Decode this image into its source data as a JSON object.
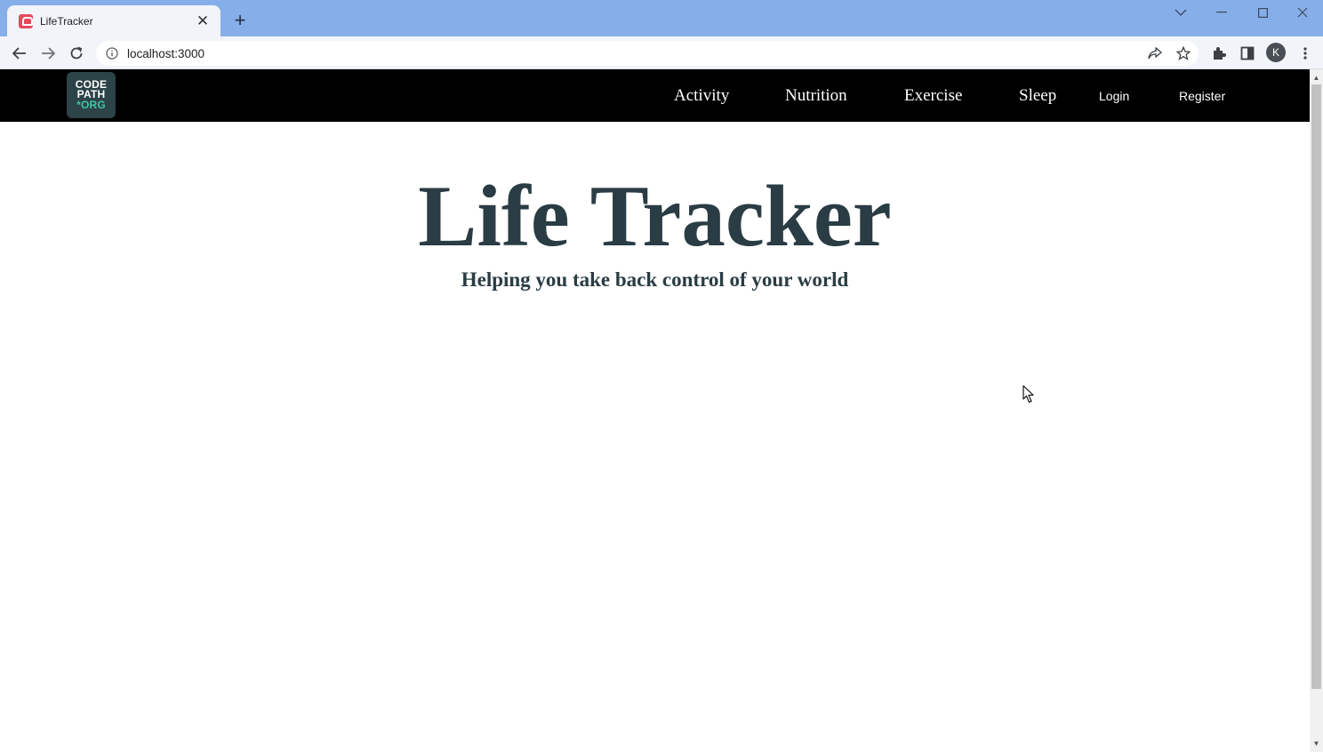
{
  "browser": {
    "tab_title": "LifeTracker",
    "new_tab_symbol": "+",
    "url": "localhost:3000",
    "profile_initial": "K"
  },
  "site": {
    "logo_lines": [
      "CODE",
      "PATH",
      "*ORG"
    ],
    "nav": {
      "activity": "Activity",
      "nutrition": "Nutrition",
      "exercise": "Exercise",
      "sleep": "Sleep",
      "login": "Login",
      "register": "Register"
    },
    "hero": {
      "title": "Life Tracker",
      "subtitle": "Helping you take back control of your world"
    }
  },
  "colors": {
    "tabstrip": "#86aee8",
    "navbar": "#000000",
    "hero_text": "#2a3c44",
    "logo_bg": "#2c4347",
    "logo_accent": "#3cc6a2"
  }
}
